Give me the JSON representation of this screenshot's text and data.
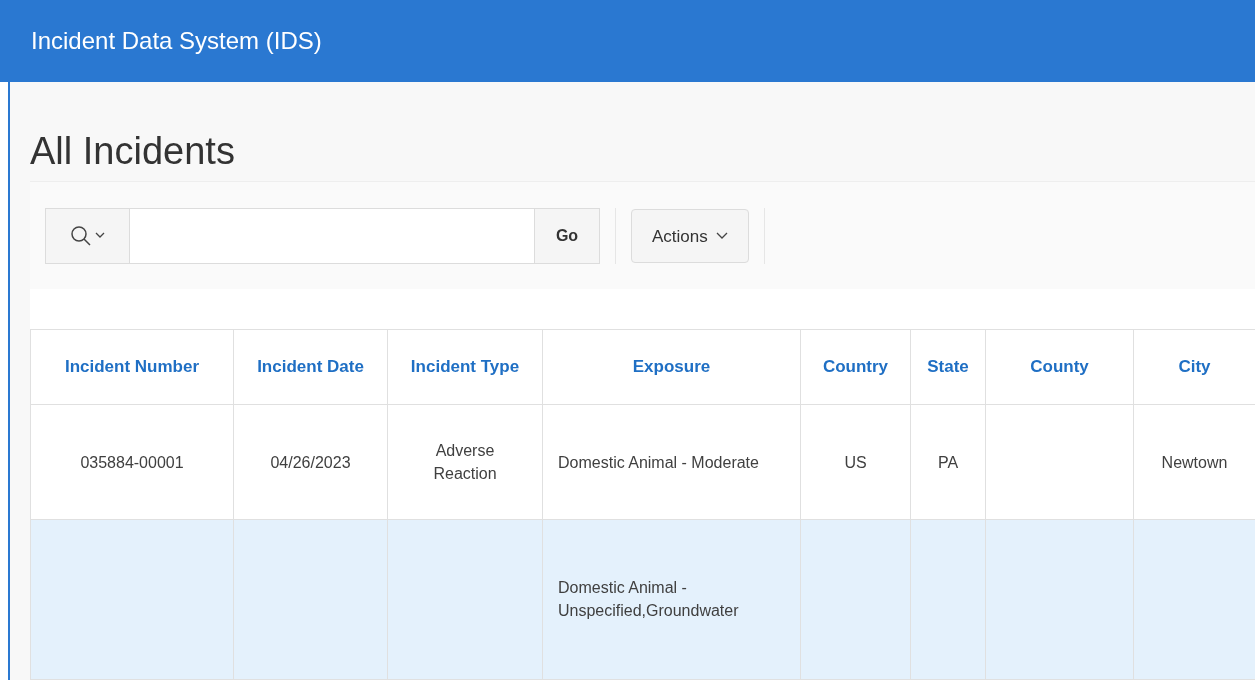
{
  "header": {
    "title": "Incident Data System (IDS)"
  },
  "page": {
    "title": "All Incidents"
  },
  "toolbar": {
    "go_button": "Go",
    "actions_button": "Actions"
  },
  "table": {
    "columns": [
      "Incident Number",
      "Incident Date",
      "Incident Type",
      "Exposure",
      "Country",
      "State",
      "County",
      "City"
    ],
    "rows": [
      {
        "selected": false,
        "cells": [
          "035884-00001",
          "04/26/2023",
          "Adverse Reaction",
          "Domestic Animal - Moderate",
          "US",
          "PA",
          null,
          "Newtown"
        ]
      },
      {
        "selected": true,
        "cells": [
          null,
          null,
          null,
          "Domestic Animal - Unspecified,Groundwater",
          null,
          null,
          null,
          null
        ]
      }
    ]
  }
}
